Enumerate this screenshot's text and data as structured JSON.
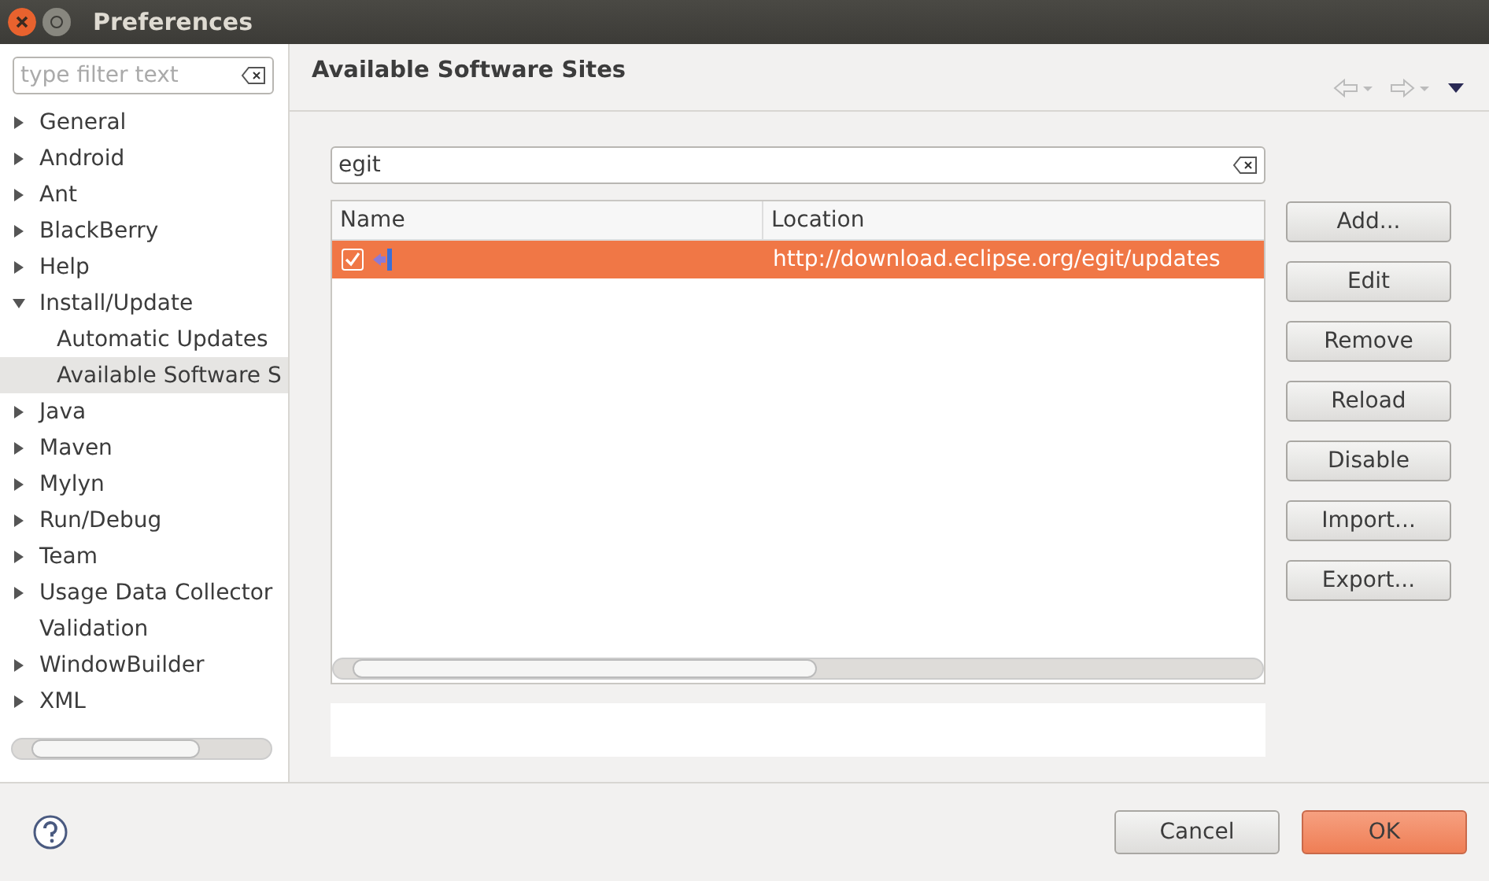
{
  "window": {
    "title": "Preferences"
  },
  "sidebar": {
    "filter": {
      "placeholder": "type filter text"
    },
    "items": [
      {
        "label": "General",
        "expandable": true,
        "expanded": false,
        "selected": false
      },
      {
        "label": "Android",
        "expandable": true,
        "expanded": false,
        "selected": false
      },
      {
        "label": "Ant",
        "expandable": true,
        "expanded": false,
        "selected": false
      },
      {
        "label": "BlackBerry",
        "expandable": true,
        "expanded": false,
        "selected": false
      },
      {
        "label": "Help",
        "expandable": true,
        "expanded": false,
        "selected": false
      },
      {
        "label": "Install/Update",
        "expandable": true,
        "expanded": true,
        "selected": false,
        "children": [
          {
            "label": "Automatic Updates",
            "expandable": false,
            "selected": false
          },
          {
            "label": "Available Software S",
            "expandable": false,
            "selected": true
          }
        ]
      },
      {
        "label": "Java",
        "expandable": true,
        "expanded": false,
        "selected": false
      },
      {
        "label": "Maven",
        "expandable": true,
        "expanded": false,
        "selected": false
      },
      {
        "label": "Mylyn",
        "expandable": true,
        "expanded": false,
        "selected": false
      },
      {
        "label": "Run/Debug",
        "expandable": true,
        "expanded": false,
        "selected": false
      },
      {
        "label": "Team",
        "expandable": true,
        "expanded": false,
        "selected": false
      },
      {
        "label": "Usage Data Collector",
        "expandable": true,
        "expanded": false,
        "selected": false
      },
      {
        "label": "Validation",
        "expandable": false,
        "selected": false
      },
      {
        "label": "WindowBuilder",
        "expandable": true,
        "expanded": false,
        "selected": false
      },
      {
        "label": "XML",
        "expandable": true,
        "expanded": false,
        "selected": false
      }
    ]
  },
  "page": {
    "title": "Available Software Sites",
    "search": {
      "value": "egit"
    },
    "table": {
      "columns": [
        "Name",
        "Location"
      ],
      "rows": [
        {
          "location": "http://download.eclipse.org/egit/updates",
          "checked": true,
          "selected": true
        }
      ]
    },
    "buttons": [
      "Add...",
      "Edit",
      "Remove",
      "Reload",
      "Disable",
      "Import...",
      "Export..."
    ]
  },
  "footer": {
    "buttons": [
      {
        "label": "Cancel",
        "kind": "normal"
      },
      {
        "label": "OK",
        "kind": "default"
      }
    ]
  }
}
